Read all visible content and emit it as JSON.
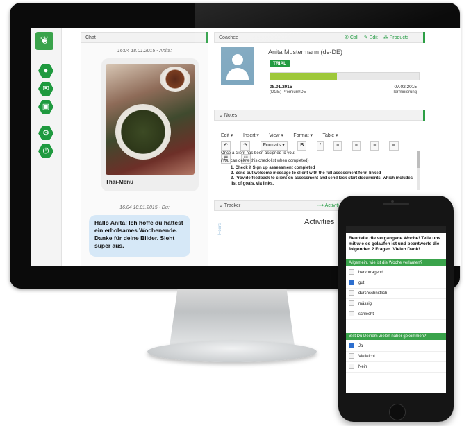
{
  "colors": {
    "brand_green": "#1f9a3f",
    "chat_bubble_blue": "#d6e8f7",
    "progress_green": "#9ec83a"
  },
  "sidebar": {
    "logo_icon": "leaf-logo",
    "buttons": [
      {
        "icon": "user-icon",
        "glyph": "●"
      },
      {
        "icon": "chat-icon",
        "glyph": "✉"
      },
      {
        "icon": "clipboard-icon",
        "glyph": "▣"
      },
      {
        "icon": "gear-icon",
        "glyph": "⚙"
      },
      {
        "icon": "power-icon",
        "glyph": "⏻"
      }
    ]
  },
  "chat": {
    "title": "Chat",
    "msg1_timestamp": "16:04 18.01.2015 - Anita:",
    "photo_caption": "Thai-Menü",
    "msg2_timestamp": "16:04 18.01.2015 - Du:",
    "msg2_text": "Hallo Anita! Ich hoffe du hattest ein erholsames Wochenende. Danke für deine Bilder. Sieht super aus."
  },
  "coaches": {
    "title": "Coachee",
    "actions": {
      "call": "Call",
      "edit": "Edit",
      "products": "Products"
    },
    "name": "Anita Mustermann (de-DE)",
    "badge": "TRIAL",
    "progress": 0.45,
    "start_date": "08.01.2015",
    "plan": "(DGE) Premium/DE",
    "end_date": "07.02.2015",
    "end_label": "Terminierung"
  },
  "notes": {
    "title": "Notes",
    "menu": [
      "Edit ▾",
      "Insert ▾",
      "View ▾",
      "Format ▾",
      "Table ▾"
    ],
    "formats_label": "Formats ▾",
    "body": {
      "line1": "Once a client has been assigned to you:",
      "line2": "(You can delete this check-list when completed)",
      "items": [
        "1.  Check if Sign up assessment completed",
        "2.  Send out welcome message to client with the full assessment form linked",
        "3.  Provide feedback to client on assessment and send kick start documents, which includes list of goals, via links."
      ]
    }
  },
  "tracker": {
    "title": "Tracker",
    "link": "Activiti",
    "chart_title": "Activities",
    "axis_label": "Hours"
  },
  "phone": {
    "question": "Beurteile die vergangene Woche! Teile uns mit wie es gelaufen ist und beantworte die folgenden 2 Fragen. Vielen Dank!",
    "q1_header": "Allgemein, wie ist die Woche verlaufen?",
    "q1_options": [
      {
        "label": "hervorragend",
        "checked": false
      },
      {
        "label": "gut",
        "checked": true
      },
      {
        "label": "durchschnittlich",
        "checked": false
      },
      {
        "label": "mässig",
        "checked": false
      },
      {
        "label": "schlecht",
        "checked": false
      }
    ],
    "q2_header": "Bist Du Deinem Zielen näher gekommen?",
    "q2_options": [
      {
        "label": "Ja",
        "checked": true
      },
      {
        "label": "Vielleicht",
        "checked": false
      },
      {
        "label": "Nein",
        "checked": false
      }
    ]
  }
}
